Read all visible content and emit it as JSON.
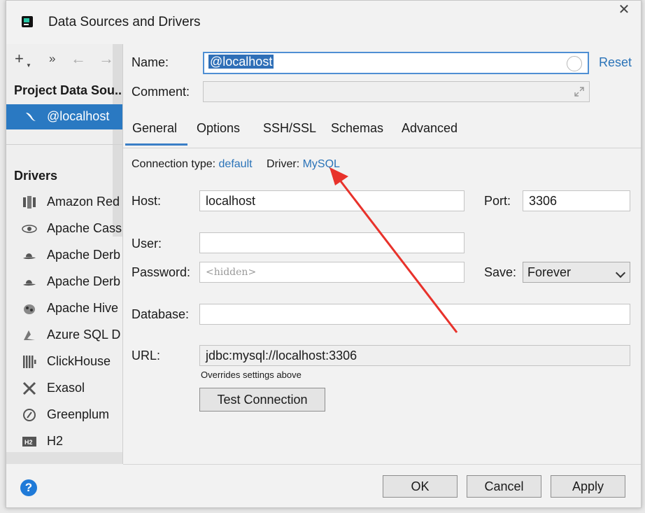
{
  "window": {
    "title": "Data Sources and Drivers",
    "close": "✕"
  },
  "left_panel": {
    "toolbar": {
      "add": "+",
      "more": "»",
      "back": "←",
      "forward": "→"
    },
    "project_section": "Project Data Sou...",
    "selected_item": "@localhost",
    "drivers_section": "Drivers",
    "drivers": [
      "Amazon Red",
      "Apache Cass",
      "Apache Derb",
      "Apache Derb",
      "Apache Hive",
      "Azure SQL D",
      "ClickHouse",
      "Exasol",
      "Greenplum",
      "H2"
    ]
  },
  "form": {
    "name_label": "Name:",
    "name_value": "@localhost",
    "reset": "Reset",
    "comment_label": "Comment:",
    "comment_value": "",
    "tabs": [
      "General",
      "Options",
      "SSH/SSL",
      "Schemas",
      "Advanced"
    ],
    "active_tab": "General",
    "connection_type_label": "Connection type:",
    "connection_type_value": "default",
    "driver_label": "Driver:",
    "driver_value": "MySQL",
    "host_label": "Host:",
    "host_value": "localhost",
    "port_label": "Port:",
    "port_value": "3306",
    "user_label": "User:",
    "user_value": "",
    "password_label": "Password:",
    "password_placeholder": "<hidden>",
    "save_label": "Save:",
    "save_value": "Forever",
    "database_label": "Database:",
    "database_value": "",
    "url_label": "URL:",
    "url_value": "jdbc:mysql://localhost:3306",
    "url_hint": "Overrides settings above",
    "test_connection": "Test Connection"
  },
  "footer": {
    "help": "?",
    "ok": "OK",
    "cancel": "Cancel",
    "apply": "Apply"
  },
  "colors": {
    "accent": "#2a79c2",
    "link": "#2a73b8",
    "arrow": "#e8322b"
  }
}
